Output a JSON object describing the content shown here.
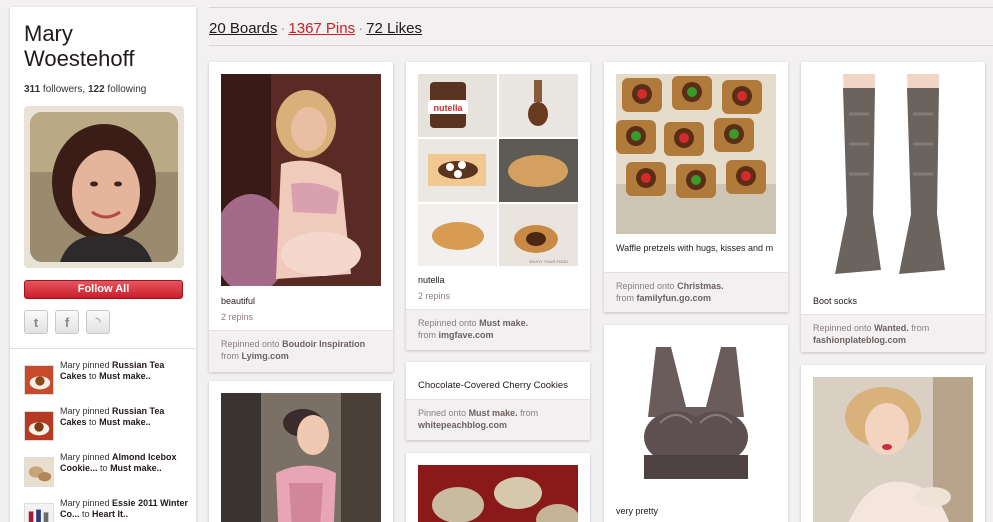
{
  "profile": {
    "name": "Mary Woestehoff",
    "followers_count": "311",
    "followers_label": "followers,",
    "following_count": "122",
    "following_label": "following"
  },
  "actions": {
    "follow_all_label": "Follow All",
    "social": [
      {
        "icon": "twitter-icon",
        "glyph": "t"
      },
      {
        "icon": "facebook-icon",
        "glyph": "f"
      },
      {
        "icon": "rss-icon",
        "glyph": "◝"
      }
    ]
  },
  "activity": [
    {
      "prefix": "Mary pinned",
      "item": "Russian Tea Cakes",
      "connector": "to",
      "board": "Must make.."
    },
    {
      "prefix": "Mary pinned",
      "item": "Russian Tea Cakes",
      "connector": "to",
      "board": "Must make.."
    },
    {
      "prefix": "Mary pinned",
      "item": "Almond Icebox Cookie...",
      "connector": "to",
      "board": "Must make.."
    },
    {
      "prefix": "Mary pinned",
      "item": "Essie 2011 Winter Co...",
      "connector": "to",
      "board": "Heart It.."
    }
  ],
  "stats": {
    "boards": "20 Boards",
    "separator": "·",
    "pins": "1367 Pins",
    "likes": "72 Likes"
  },
  "pins": {
    "p1": {
      "description": "beautiful",
      "repins": "2 repins",
      "footer_prefix": "Repinned onto",
      "board": "Boudoir Inspiration",
      "from_label": "from",
      "source": "Lyimg.com"
    },
    "p2": {
      "image_caption": "nutella",
      "overlay_text": "ENJOY YOUR FOOD",
      "description": "nutella",
      "repins": "2 repins",
      "footer_prefix": "Repinned onto",
      "board": "Must make.",
      "from_label": "from",
      "source": "imgfave.com"
    },
    "p3": {
      "description": "Chocolate-Covered Cherry Cookies",
      "footer_prefix": "Pinned onto",
      "board": "Must make.",
      "from_label": "from",
      "source": "whitepeachblog.com"
    },
    "p4": {
      "description": "Waffle pretzels with hugs, kisses and m",
      "footer_prefix": "Repinned onto",
      "board": "Christmas.",
      "from_label": "from",
      "source": "familyfun.go.com"
    },
    "p5": {
      "description": "very pretty"
    },
    "p6": {
      "description": "Boot socks",
      "footer_prefix": "Repinned onto",
      "board": "Wanted.",
      "from_label": "from",
      "source": "fashionplateblog.com"
    }
  },
  "colors": {
    "brand_red": "#cb2027",
    "background": "#f2f0f0",
    "muted_text": "#8c7e7e"
  }
}
